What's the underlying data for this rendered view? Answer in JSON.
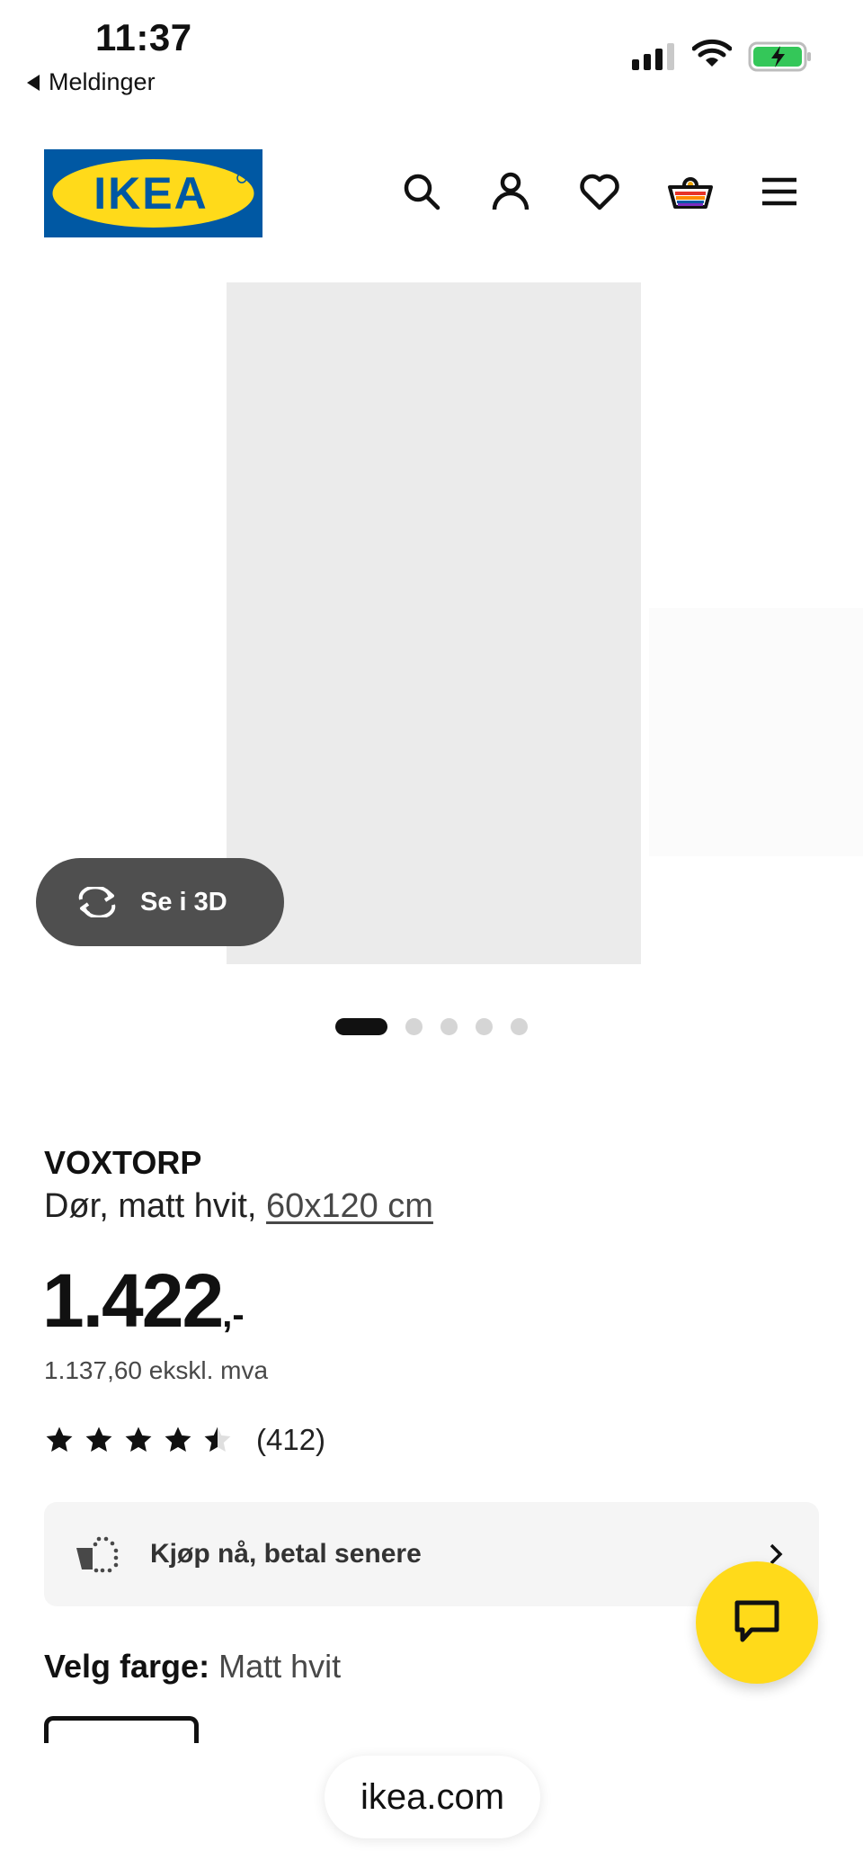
{
  "status_bar": {
    "time": "11:37",
    "back_label": "Meldinger"
  },
  "header": {
    "logo_text": "IKEA",
    "icons": [
      "search-icon",
      "profile-icon",
      "heart-icon",
      "cart-icon",
      "menu-icon"
    ],
    "brand_colors": {
      "blue": "#0058a3",
      "yellow": "#ffda1a"
    }
  },
  "gallery": {
    "view_3d_label": "Se i 3D",
    "slide_count": 5,
    "active_slide": 1
  },
  "product": {
    "name": "VOXTORP",
    "description": "Dør, matt hvit,",
    "size_link": "60x120 cm",
    "price_main": "1.422",
    "price_suffix": ",-",
    "price_ex_vat": "1.137,60 ekskl. mva",
    "rating": 4.5,
    "reviews_count": "(412)"
  },
  "bnpl": {
    "label": "Kjøp nå, betal senere"
  },
  "color_select": {
    "label": "Velg farge:",
    "value": "Matt hvit"
  },
  "browser": {
    "url": "ikea.com"
  }
}
